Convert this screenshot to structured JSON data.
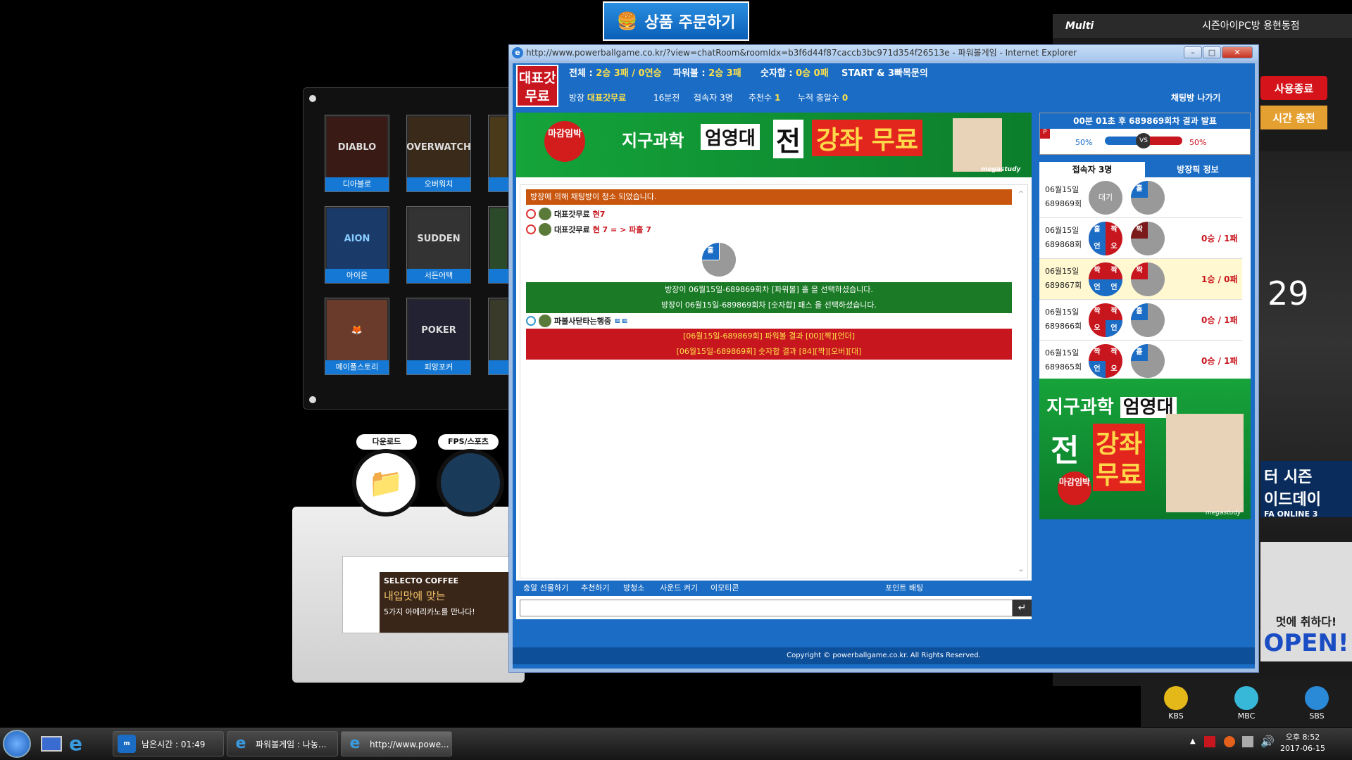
{
  "order_button": {
    "label": "상품 주문하기"
  },
  "launcher": {
    "games": [
      "디아블로",
      "오버워치",
      "아이온",
      "서든어택",
      "메이플스토리",
      "피망포커"
    ],
    "categories": [
      "다운로드",
      "FPS/스포츠"
    ]
  },
  "coffee_ad": {
    "brand": "SELECTO COFFEE",
    "line1": "내입맛에 맞는",
    "line2": "5가지 아메리카노를 만나다!"
  },
  "right_panel": {
    "brand": "Multi",
    "title": "시즌아이PC방 용현동점",
    "end_label": "사용종료",
    "charge_label": "시간 충전",
    "clock": "29",
    "fifa_line1": "터 시즌",
    "fifa_line2": "이드데이",
    "fifa_brand": "FA ONLINE 3",
    "open_text": "OPEN!",
    "open_sub": "멋에 취하다!",
    "tv": [
      "KBS",
      "MBC",
      "SBS"
    ]
  },
  "window": {
    "title": "http://www.powerballgame.co.kr/?view=chatRoom&roomIdx=b3f6d44f87caccb3bc971d354f26513e - 파워볼게임 - Internet Explorer"
  },
  "room": {
    "logo": "대표갓무료",
    "stats": {
      "total_label": "전체 :",
      "total": "2승 3패 / 0연승",
      "powerball_label": "파워볼 :",
      "powerball": "2승 3패",
      "sum_label": "숫자합 :",
      "sum": "0승 0패",
      "start": "START & 3빠목문의"
    },
    "info": {
      "owner_label": "방장",
      "owner": "대표갓무료",
      "duration": "16분전",
      "users_label": "접속자",
      "users": "3명",
      "recommend_label": "추천수",
      "recommend": "1",
      "hearts_label": "누적 충알수",
      "hearts": "0",
      "leave": "채팅방 나가기"
    }
  },
  "banner": {
    "badge": "마감임박",
    "text1": "지구과학",
    "text2": "엄영대",
    "text3": "전",
    "text4": "강좌 무료",
    "brand": "megastudy"
  },
  "chat": {
    "notice": "방장에 의해 채팅방이 청소 되었습니다.",
    "line1_name": "대표갓무료",
    "line1_msg": "현7",
    "line2_name": "대표갓무료",
    "line2_msg": "현 7 = > 파홀 7",
    "ball_label": "홀",
    "sys1": "방장이 06월15일-689869회차 [파워볼] 홀 을 선택하셨습니다.",
    "sys2": "방장이 06월15일-689869회차 [숫자합] 패스 을 선택하셨습니다.",
    "line3_name": "파볼사닫타는행중",
    "line3_msg": "ㅌㅌ",
    "res1": "[06월15일-689869회] 파워볼 결과 [00][짝][언더]",
    "res2": "[06월15일-689869회] 숫자합 결과 [84][짝][오버][대]"
  },
  "chat_footer": {
    "gift": "충알 선물하기",
    "recommend": "추천하기",
    "clean": "방청소",
    "sound": "사운드 켜기",
    "emoticon": "이모티콘",
    "point": "포인트 배팅"
  },
  "result": {
    "header": "00분 01초 후 689869회차 결과 발표",
    "left": "50%",
    "vs": "VS",
    "right": "50%"
  },
  "tabs": {
    "users": "접속자 3명",
    "room_info": "방장픽 정보"
  },
  "history": [
    {
      "date": "06월15일",
      "round": "689869회",
      "status": "대기",
      "pick": "홀",
      "record": ""
    },
    {
      "date": "06월15일",
      "round": "689868회",
      "pick": "짝",
      "record": "0승 / 1패"
    },
    {
      "date": "06월15일",
      "round": "689867회",
      "pick": "짝",
      "record": "1승 / 0패"
    },
    {
      "date": "06월15일",
      "round": "689866회",
      "pick": "홀",
      "record": "0승 / 1패"
    },
    {
      "date": "06월15일",
      "round": "689865회",
      "pick": "홀",
      "record": "0승 / 1패"
    }
  ],
  "ad2": {
    "text1": "지구과학",
    "text2": "엄영대",
    "text3": "전",
    "text4": "강좌",
    "text5": "무료",
    "badge": "마감임박",
    "brand": "megastudy"
  },
  "copyright": "Copyright © powerballgame.co.kr. All Rights Reserved.",
  "taskbar": {
    "remaining": "남은시간 : 01:49",
    "task1": "파워볼게임 : 나농...",
    "task2": "http://www.powe...",
    "time": "오후 8:52",
    "date": "2017-06-15"
  },
  "colors": {
    "accent": "#1a6cc4",
    "red": "#c8161e",
    "green": "#1a7a25",
    "orange": "#c9560e"
  }
}
